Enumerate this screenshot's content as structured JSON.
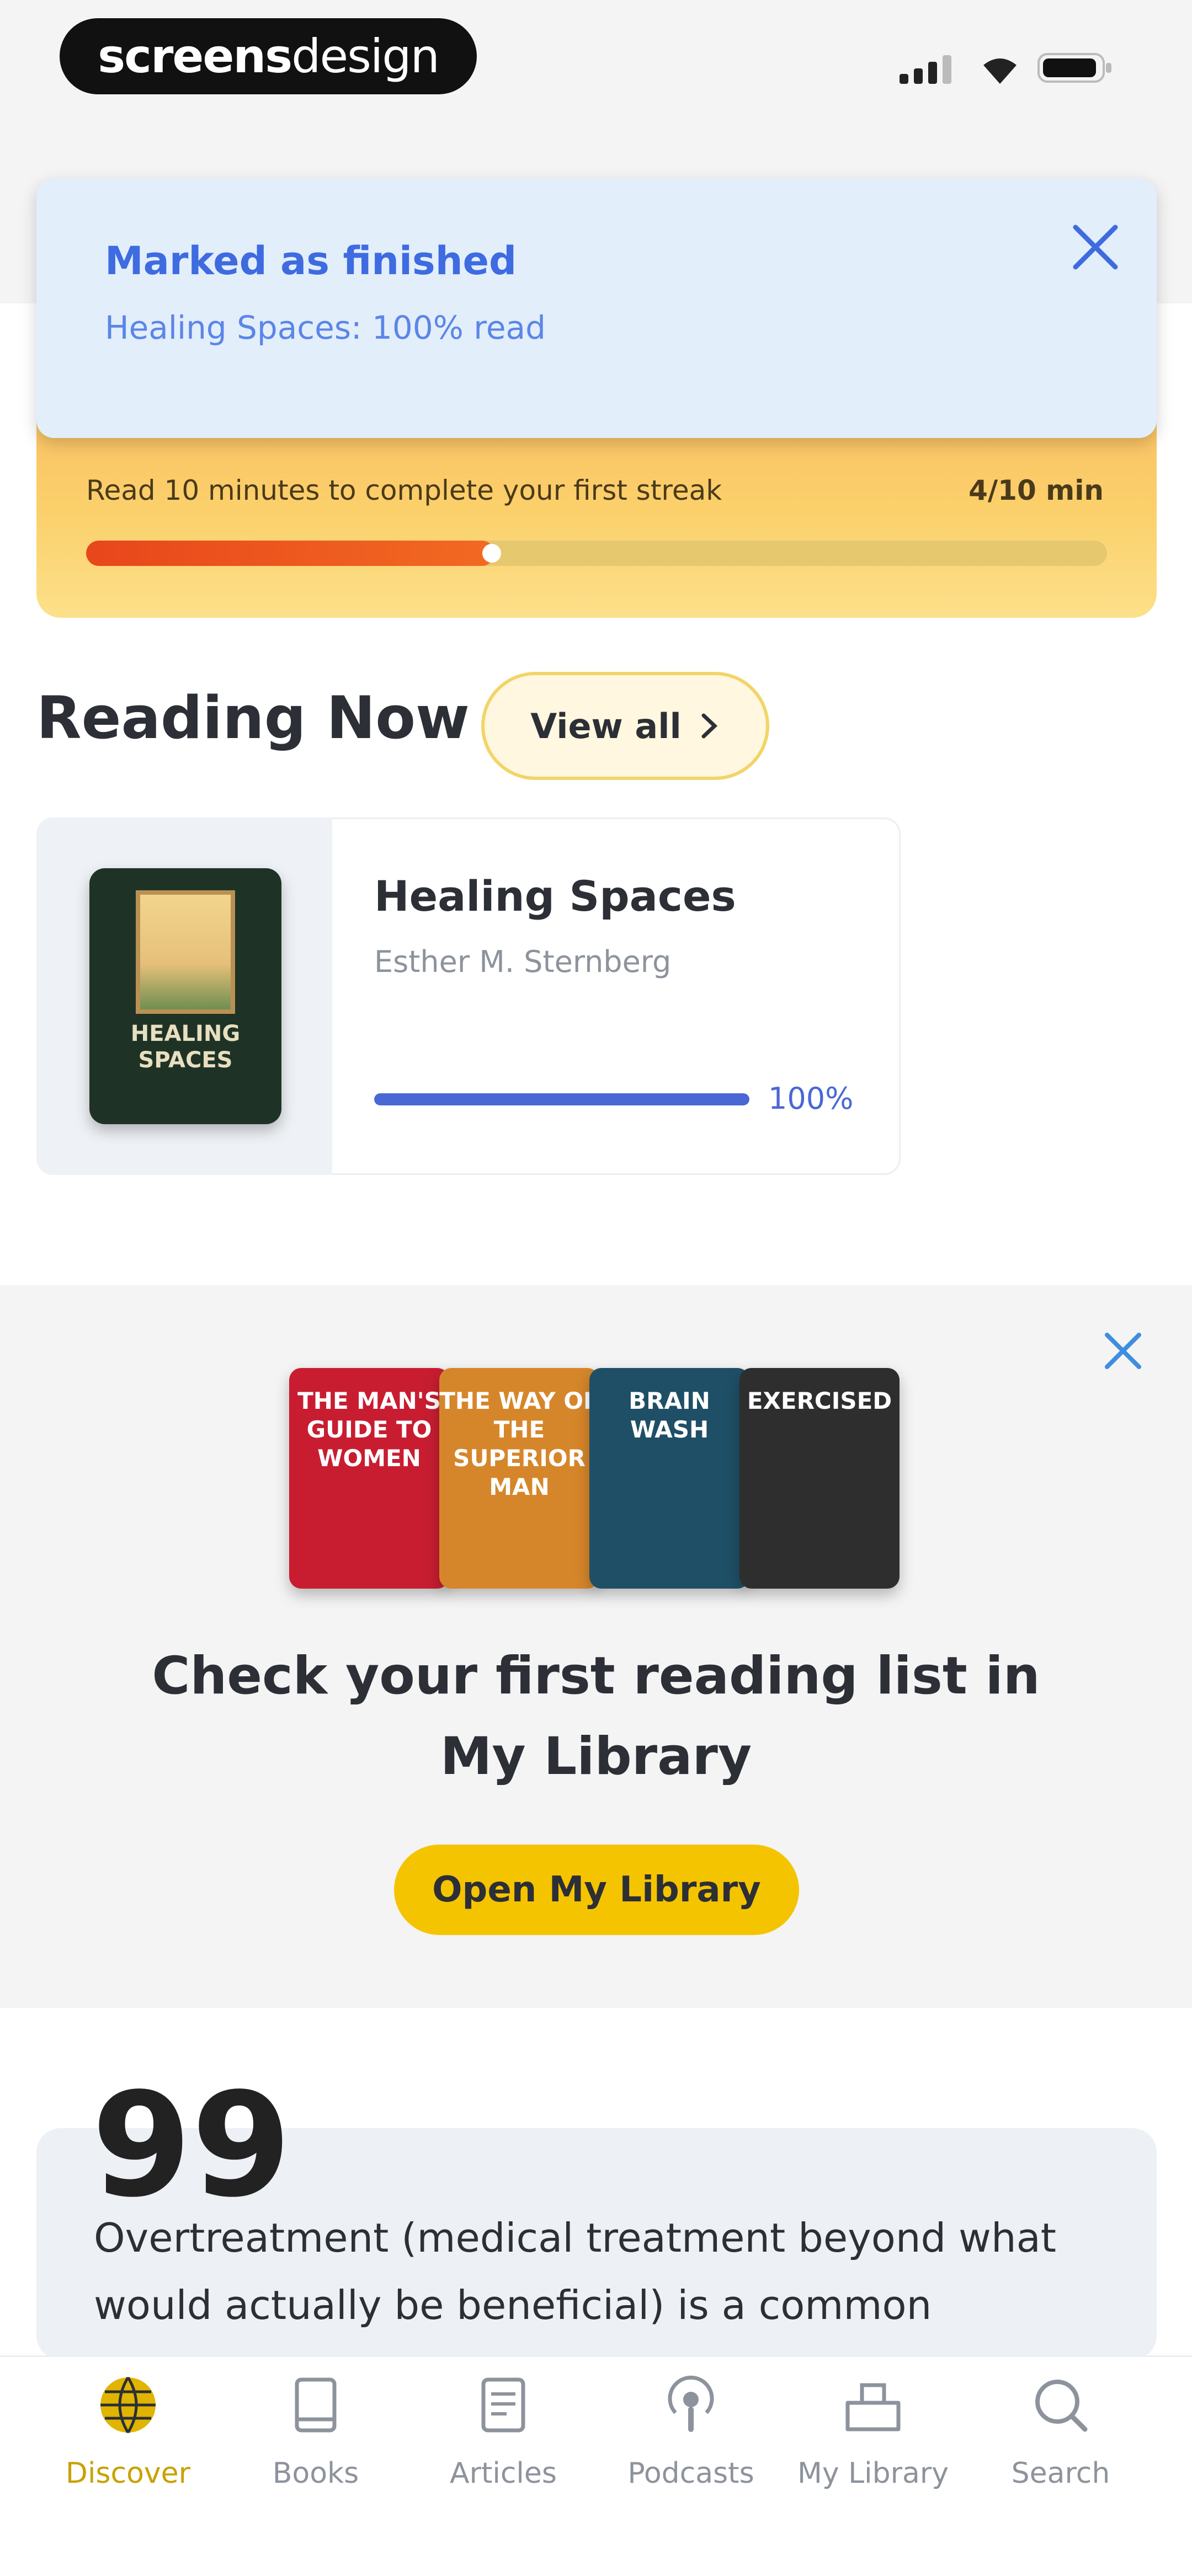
{
  "status_bar": {
    "brand_bold": "screens",
    "brand_light": "design"
  },
  "toast": {
    "title": "Marked as finished",
    "subtitle": "Healing Spaces: 100% read"
  },
  "streak": {
    "text": "Read 10 minutes to complete your first streak",
    "count": "4/10 min",
    "progress": 0.4
  },
  "reading_now": {
    "title": "Reading Now",
    "view_all_label": "View all",
    "book": {
      "title": "Healing Spaces",
      "author": "Esther M. Sternberg",
      "cover_title": "HEALING SPACES",
      "progress": 1.0,
      "percent_label": "100%"
    }
  },
  "promo": {
    "books": [
      {
        "title": "THE MAN'S GUIDE TO WOMEN",
        "color": "#c81d31"
      },
      {
        "title": "THE WAY OF THE SUPERIOR MAN",
        "color": "#d6862a"
      },
      {
        "title": "BRAIN WASH",
        "color": "#1f4f66"
      },
      {
        "title": "EXERCISED",
        "color": "#2e2e2e"
      }
    ],
    "text": "Check your first reading list in My Library",
    "button_label": "Open My Library"
  },
  "quote": {
    "mark": "99",
    "text": "Overtreatment (medical treatment beyond what would actually be beneficial) is a common"
  },
  "nav": {
    "items": [
      {
        "label": "Discover",
        "icon": "globe-icon",
        "active": true
      },
      {
        "label": "Books",
        "icon": "book-icon",
        "active": false
      },
      {
        "label": "Articles",
        "icon": "article-icon",
        "active": false
      },
      {
        "label": "Podcasts",
        "icon": "podcast-icon",
        "active": false
      },
      {
        "label": "My Library",
        "icon": "library-icon",
        "active": false
      },
      {
        "label": "Search",
        "icon": "search-icon",
        "active": false
      }
    ]
  },
  "colors": {
    "accent_yellow": "#f5c400",
    "accent_blue": "#4a67d6",
    "toast_bg": "#e3eefb"
  }
}
